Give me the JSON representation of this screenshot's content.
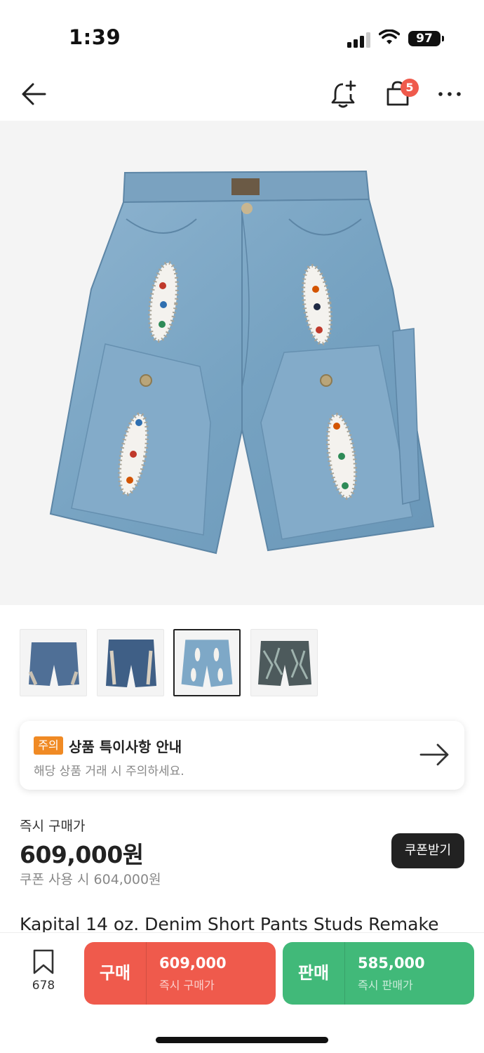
{
  "status_bar": {
    "time": "1:39",
    "battery": "97"
  },
  "header": {
    "back_icon": "arrow-left-icon",
    "alert_icon": "bell-plus-icon",
    "cart_icon": "shopping-bag-icon",
    "cart_badge": "5",
    "more_icon": "more-horizontal-icon"
  },
  "gallery": {
    "selected_index": 2,
    "thumbnail_count": 4
  },
  "notice": {
    "badge": "주의",
    "title": "상품 특이사항 안내",
    "subtitle": "해당 상품 거래 시 주의하세요.",
    "icon": "arrow-right-icon"
  },
  "price": {
    "label": "즉시 구매가",
    "value": "609,000원",
    "coupon_price": "쿠폰 사용 시 604,000원",
    "coupon_button": "쿠폰받기"
  },
  "product": {
    "title": "Kapital 14 oz. Denim Short Pants Studs Remake"
  },
  "bottom_bar": {
    "wish_count": "678",
    "buy": {
      "label": "구매",
      "price": "609,000",
      "sub": "즉시 구매가"
    },
    "sell": {
      "label": "판매",
      "price": "585,000",
      "sub": "즉시 판매가"
    }
  },
  "colors": {
    "buy": "#ef5a4c",
    "sell": "#41b979",
    "badge": "#f08a24",
    "denim": "#7fa9c6"
  }
}
